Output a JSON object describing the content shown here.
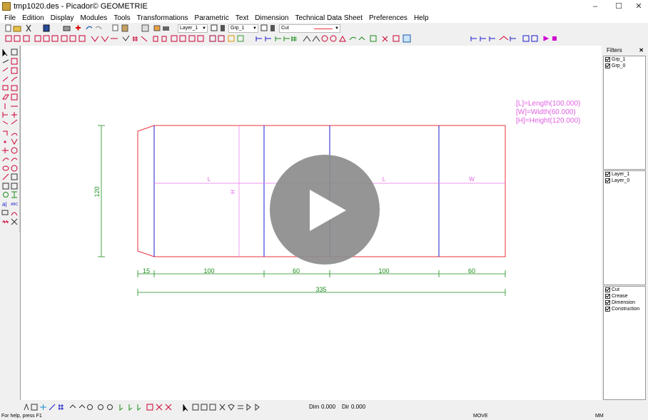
{
  "window": {
    "title": "tmp1020.des - Picador© GEOMETRIE",
    "minimize": "–",
    "maximize": "☐",
    "close": "✕"
  },
  "menu": [
    "File",
    "Edition",
    "Display",
    "Modules",
    "Tools",
    "Transformations",
    "Parametric",
    "Text",
    "Dimension",
    "Technical Data Sheet",
    "Preferences",
    "Help"
  ],
  "toolbar": {
    "layer_combo": "Layer_1",
    "group_combo": "Grp_1",
    "linetype_combo": "Cut"
  },
  "filters": {
    "title": "Filters",
    "close": "✕",
    "groups": [
      "Grp_1",
      "Grp_0"
    ],
    "layers": [
      "Layer_1",
      "Layer_0"
    ],
    "linetypes": [
      "Cut",
      "Crease",
      "Dimension",
      "Construction"
    ]
  },
  "drawing": {
    "params": [
      "[L]=Length(100.000)",
      "[W]=Width(60.000)",
      "[H]=Height(120.000)"
    ],
    "panel_labels": [
      "L",
      "H",
      "L",
      "W"
    ],
    "dims_bottom": [
      "15",
      "100",
      "60",
      "100",
      "60"
    ],
    "dim_total": "335",
    "dim_height": "120"
  },
  "bottom_toolbar": {
    "dim_label": "Dim",
    "dim_value": "0.000",
    "dir_label": "Dir",
    "dir_value": "0.000"
  },
  "status": {
    "help": "For help, press F1",
    "mode": "MOVE",
    "units": "MM"
  },
  "colors": {
    "cut": "#e8323c",
    "crease": "#1d1dcc",
    "dimension": "#1a8c1a",
    "param_text": "#e060e0",
    "construction": "#e878e8"
  }
}
